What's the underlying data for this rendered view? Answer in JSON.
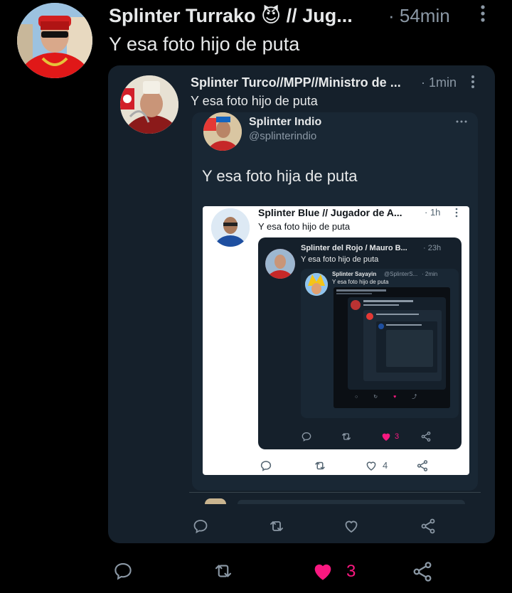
{
  "colors": {
    "background": "#000000",
    "card_dark": "#15202b",
    "text": "#e7e9ea",
    "muted": "#8b98a5",
    "like": "#f91880"
  },
  "tweet": {
    "author_name": "Splinter Turrako 😈 // Jug...",
    "time": "· 54min",
    "text": "Y esa foto hijo de puta",
    "like_count": "3"
  },
  "quote1": {
    "author_name": "Splinter Turco//MPP//Ministro de ...",
    "time": "· 1min",
    "text": "Y esa foto hijo de puta"
  },
  "quote2": {
    "author_name": "Splinter Indio",
    "handle": "@splinterindio",
    "text": "Y esa foto hija de puta"
  },
  "quote3": {
    "author_name": "Splinter Blue // Jugador de A...",
    "time": "· 1h",
    "text": "Y esa foto hijo de puta",
    "like_count": "4"
  },
  "quote4": {
    "author_name": "Splinter del Rojo / Mauro B...",
    "time": "· 23h",
    "text": "Y esa foto hijo de puta",
    "like_count": "3"
  },
  "quote5": {
    "author_name": "Splinter Sayayin",
    "handle": "@SplinterS...",
    "time": "· 2min",
    "text": "Y esa foto hijo de puta"
  }
}
